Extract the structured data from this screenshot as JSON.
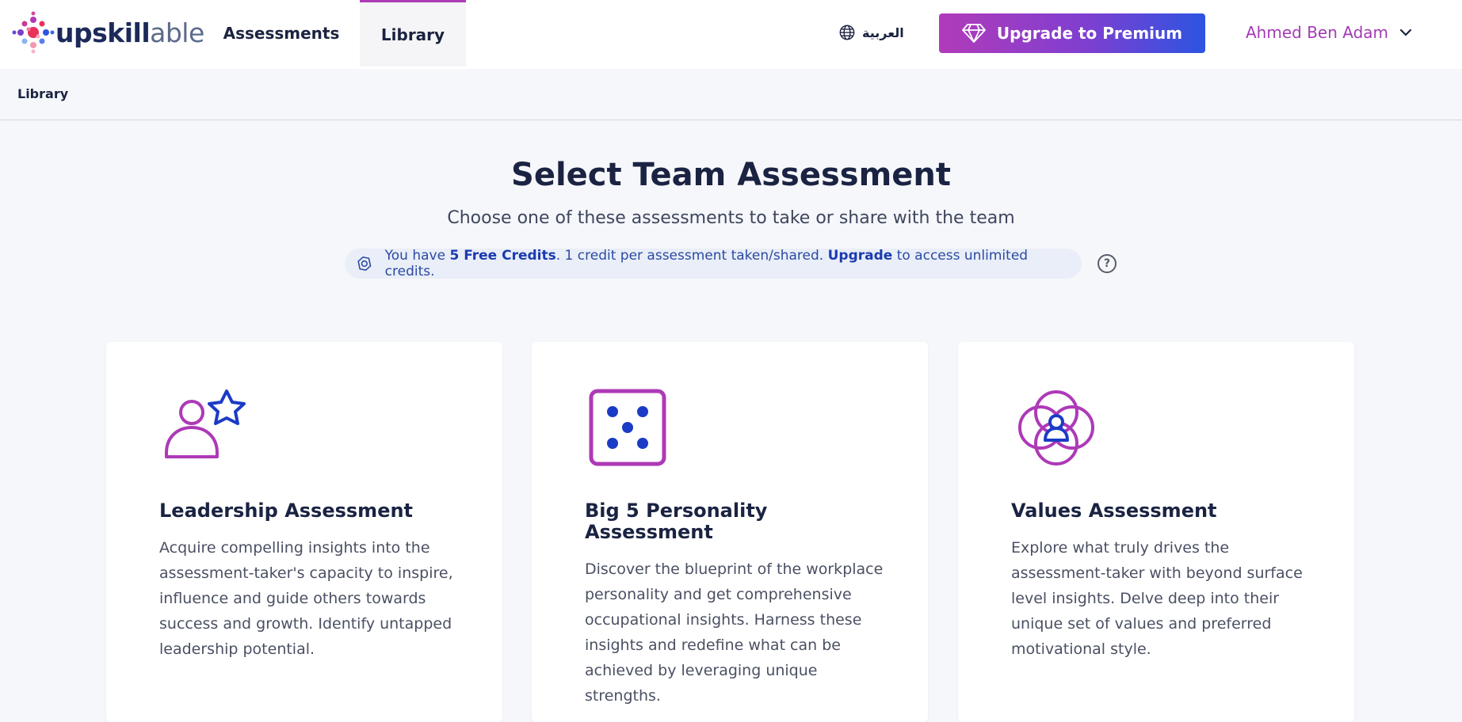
{
  "brand": {
    "name_part1": "upskill",
    "name_part2": "able"
  },
  "nav": {
    "items": [
      {
        "label": "Assessments",
        "active": false
      },
      {
        "label": "Library",
        "active": true
      }
    ]
  },
  "header": {
    "language_label": "العربية",
    "upgrade_label": "Upgrade to Premium",
    "user_name": "Ahmed Ben Adam"
  },
  "breadcrumb": {
    "current": "Library"
  },
  "main": {
    "title": "Select Team Assessment",
    "subtitle": "Choose one of these assessments to take or share with the team",
    "credits": {
      "prefix": "You have ",
      "count_label": "5 Free Credits",
      "middle": ". 1 credit per assessment taken/shared. ",
      "upgrade_link": "Upgrade",
      "suffix": " to access unlimited credits."
    },
    "help_symbol": "?"
  },
  "cards": [
    {
      "title": "Leadership Assessment",
      "description": "Acquire compelling insights into the assessment-taker's capacity to inspire, influence and guide others towards success and growth. Identify untapped leadership potential.",
      "icon": "leader-star-icon"
    },
    {
      "title": "Big 5 Personality Assessment",
      "description": "Discover the blueprint of the workplace personality and get comprehensive occupational insights. Harness these insights and redefine what can be achieved by leveraging unique strengths.",
      "icon": "dice-icon"
    },
    {
      "title": "Values Assessment",
      "description": "Explore what truly drives the assessment-taker with beyond surface level insights. Delve deep into their unique set of values and preferred motivational style.",
      "icon": "values-circles-icon"
    }
  ],
  "colors": {
    "accent_purple": "#ad3ab7",
    "accent_blue": "#1b3bb0",
    "upgrade_gradient_start": "#b13bb9",
    "upgrade_gradient_end": "#2c54e2"
  }
}
